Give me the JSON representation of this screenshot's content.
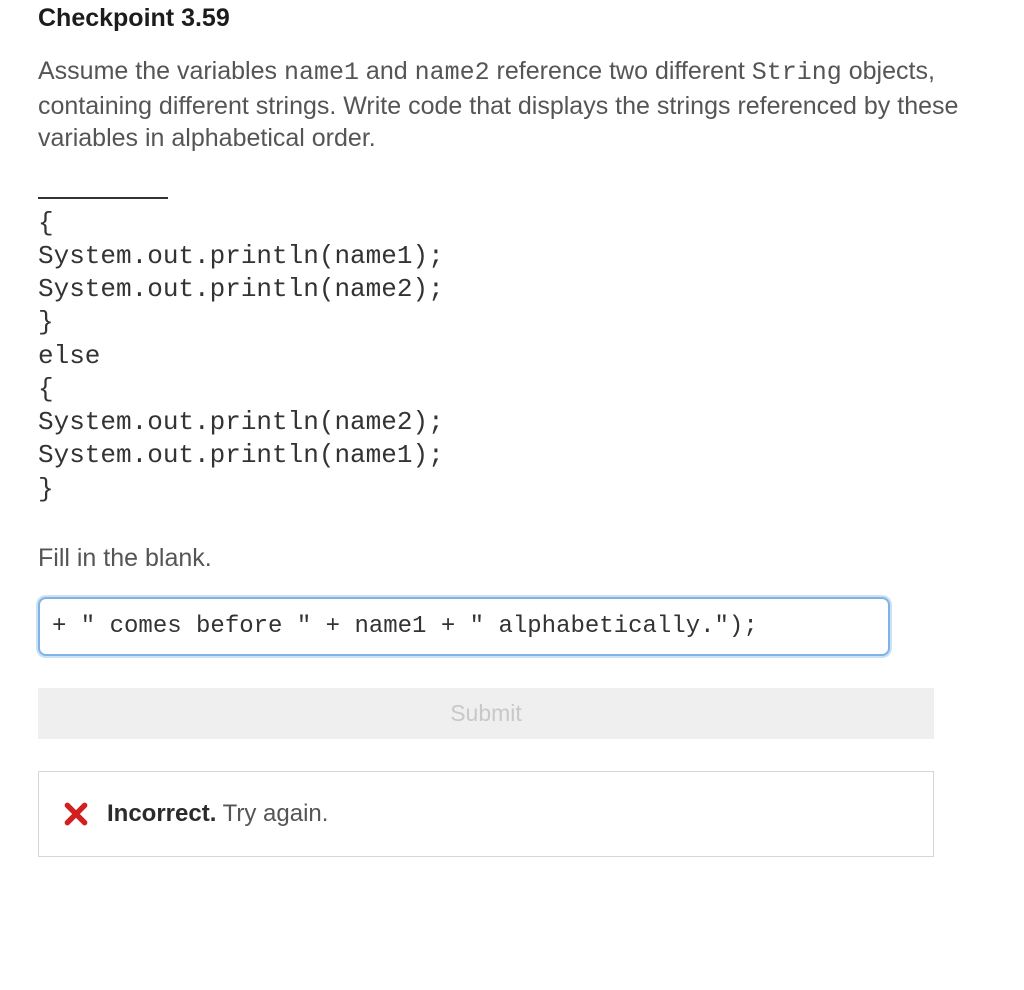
{
  "title": "Checkpoint 3.59",
  "question": {
    "pre1": "Assume the variables ",
    "code1": "name1",
    "mid1": " and ",
    "code2": "name2",
    "mid2": " reference two different ",
    "code3": "String",
    "post": " objects, containing different strings. Write code that displays the strings referenced by these variables in alphabetical order."
  },
  "code_block": "{\nSystem.out.println(name1);\nSystem.out.println(name2);\n}\nelse\n{\nSystem.out.println(name2);\nSystem.out.println(name1);\n}",
  "fill_prompt": "Fill in the blank.",
  "answer_value": "+ \" comes before \" + name1 + \" alphabetically.\"); ",
  "submit_label": "Submit",
  "feedback": {
    "status_strong": "Incorrect.",
    "status_rest": " Try again."
  }
}
